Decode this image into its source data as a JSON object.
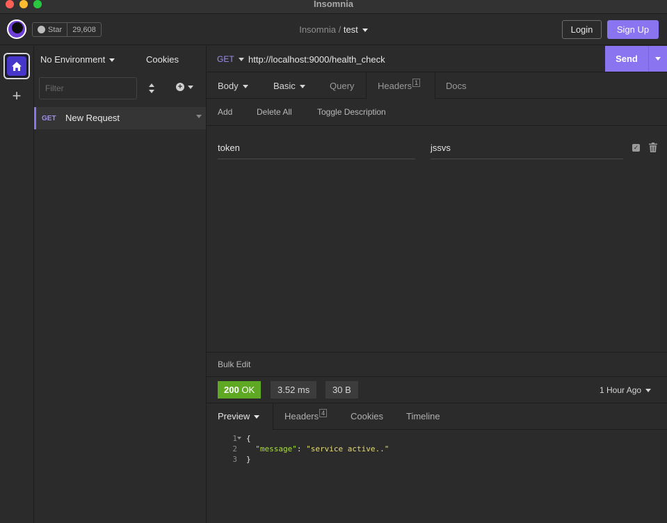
{
  "window": {
    "title": "Insomnia"
  },
  "header": {
    "star_label": "Star",
    "star_count": "29,608",
    "breadcrumb_root": "Insomnia",
    "breadcrumb_sep": "/",
    "project": "test",
    "login_label": "Login",
    "signup_label": "Sign Up"
  },
  "sidebar": {
    "environment": "No Environment",
    "cookies": "Cookies",
    "filter_placeholder": "Filter",
    "requests": [
      {
        "method": "GET",
        "name": "New Request"
      }
    ]
  },
  "request": {
    "method": "GET",
    "url": "http://localhost:9000/health_check",
    "send_label": "Send",
    "tabs": {
      "body": "Body",
      "auth": "Basic",
      "query": "Query",
      "headers": "Headers",
      "headers_count": "1",
      "docs": "Docs"
    },
    "actions": {
      "add": "Add",
      "delete_all": "Delete All",
      "toggle_description": "Toggle Description"
    },
    "header_rows": [
      {
        "name": "token",
        "value": "jssvs"
      }
    ],
    "bulk_edit": "Bulk Edit"
  },
  "response": {
    "status_code": "200",
    "status_text": "OK",
    "time": "3.52 ms",
    "size": "30 B",
    "time_ago": "1 Hour Ago",
    "tabs": {
      "preview": "Preview",
      "headers": "Headers",
      "headers_count": "4",
      "cookies": "Cookies",
      "timeline": "Timeline"
    },
    "lines": [
      {
        "num": "1",
        "text": "{"
      },
      {
        "num": "2",
        "key": "\"message\"",
        "sep": ": ",
        "value": "\"service active..\""
      },
      {
        "num": "3",
        "text": "}"
      }
    ]
  },
  "colors": {
    "accent": "#8b74ef",
    "status_ok": "#5ea823",
    "background": "#2b2b2b"
  }
}
